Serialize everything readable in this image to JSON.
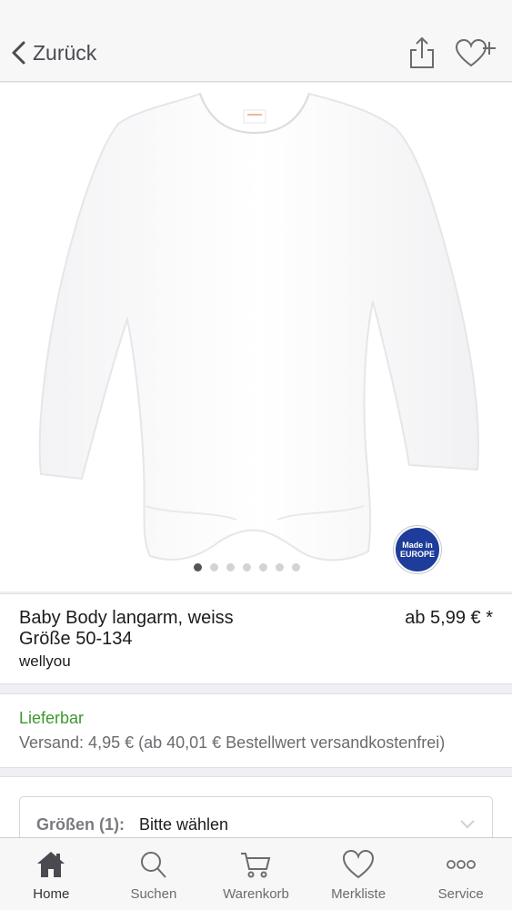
{
  "nav": {
    "back_label": "Zurück"
  },
  "gallery": {
    "dots": 7,
    "active_dot": 0,
    "badge_line1": "Made in",
    "badge_line2": "EUROPE"
  },
  "product": {
    "title": "Baby Body langarm, weiss",
    "size_range": "Größe 50-134",
    "brand": "wellyou",
    "price": "ab 5,99 € *"
  },
  "availability": {
    "status": "Lieferbar",
    "shipping": "Versand: 4,95 € (ab 40,01 € Bestellwert versandkostenfrei)"
  },
  "size_select": {
    "label": "Größen (1):",
    "value": "Bitte wählen"
  },
  "tabs": [
    {
      "label": "Home",
      "icon": "home-icon"
    },
    {
      "label": "Suchen",
      "icon": "search-icon"
    },
    {
      "label": "Warenkorb",
      "icon": "cart-icon"
    },
    {
      "label": "Merkliste",
      "icon": "heart-icon"
    },
    {
      "label": "Service",
      "icon": "more-icon"
    }
  ],
  "colors": {
    "available": "#3a9a2c",
    "badge": "#1e3d9a",
    "icon": "#6b6b70"
  }
}
